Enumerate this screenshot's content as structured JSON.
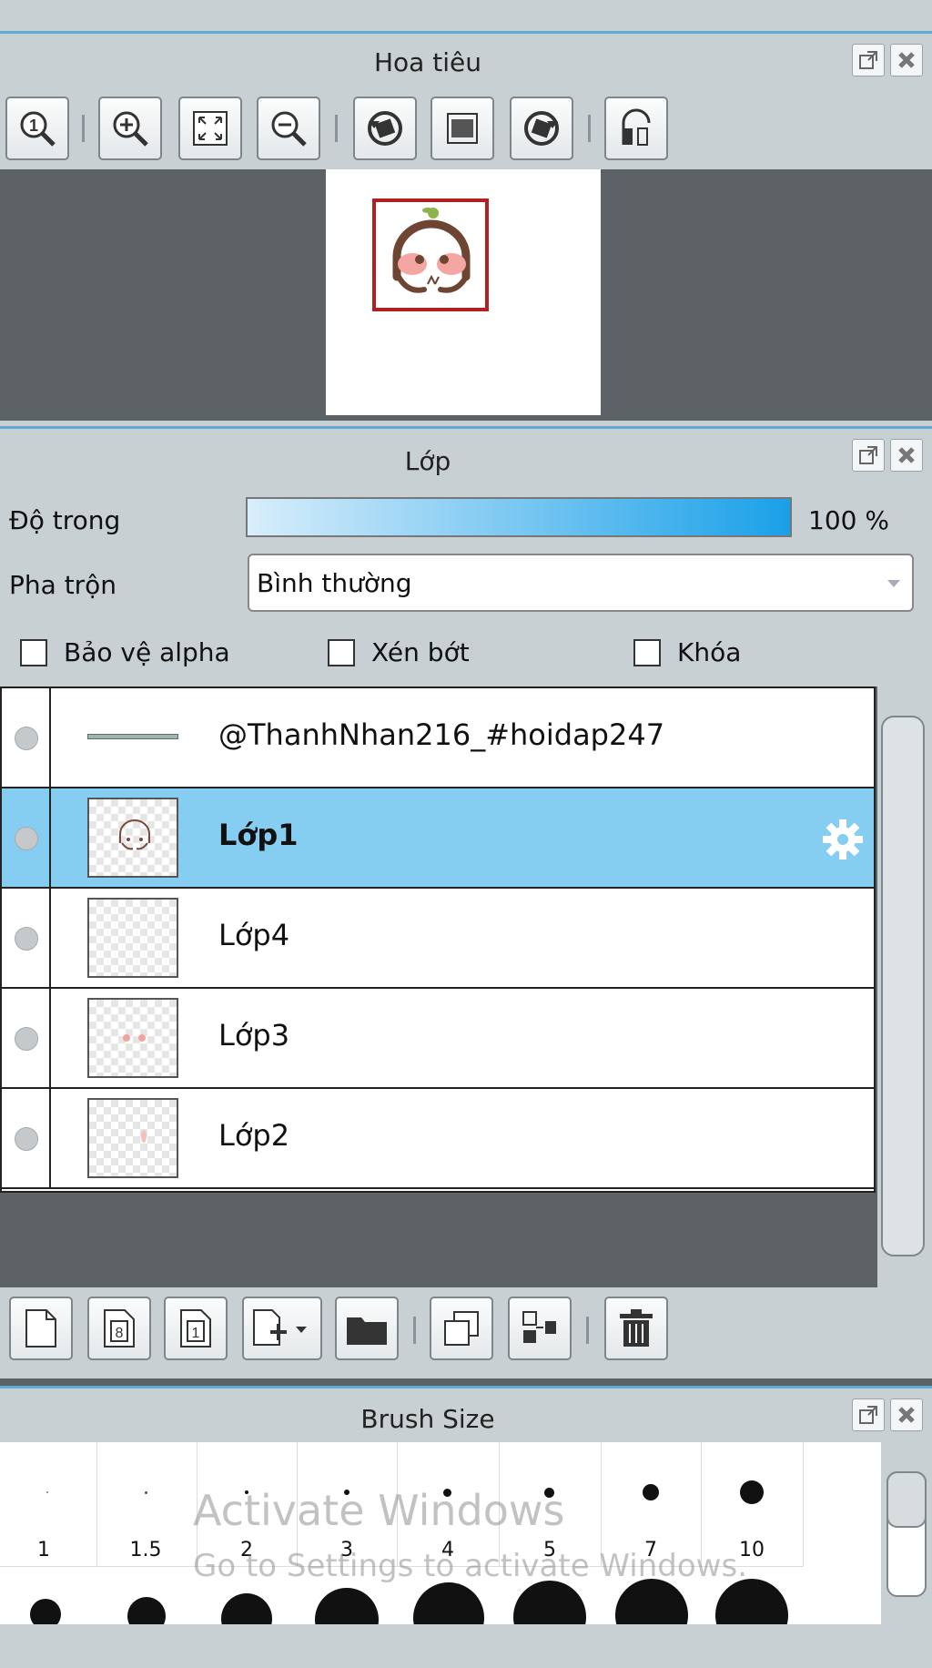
{
  "navigator": {
    "title": "Hoa tiêu",
    "toolbar": [
      {
        "name": "zoom-actual-icon",
        "glyph": "1"
      },
      {
        "name": "zoom-in-icon",
        "glyph": "+"
      },
      {
        "name": "fit-window-icon",
        "glyph": "⤢"
      },
      {
        "name": "zoom-out-icon",
        "glyph": "−"
      },
      {
        "name": "rotate-left-icon",
        "glyph": "↺"
      },
      {
        "name": "reset-rotation-icon",
        "glyph": "▣"
      },
      {
        "name": "rotate-right-icon",
        "glyph": "↻"
      },
      {
        "name": "flip-horizontal-icon",
        "glyph": "◧"
      }
    ]
  },
  "layers": {
    "title": "Lớp",
    "opacity_label": "Độ trong",
    "opacity_value": "100 %",
    "opacity_percent": 100,
    "blend_label": "Pha trộn",
    "blend_value": "Bình thường",
    "checkboxes": {
      "alpha_protect": "Bảo vệ alpha",
      "clipping": "Xén bớt",
      "lock": "Khóa"
    },
    "items": [
      {
        "name": "@ThanhNhan216_#hoidap247",
        "selected": false,
        "kind": "line"
      },
      {
        "name": "Lớp1",
        "selected": true,
        "kind": "face"
      },
      {
        "name": "Lớp4",
        "selected": false,
        "kind": "blank"
      },
      {
        "name": "Lớp3",
        "selected": false,
        "kind": "cheeks"
      },
      {
        "name": "Lớp2",
        "selected": false,
        "kind": "mark"
      }
    ],
    "bottom_toolbar": [
      {
        "name": "new-layer-icon",
        "glyph": ""
      },
      {
        "name": "new-8bit-layer-icon",
        "glyph": "8"
      },
      {
        "name": "new-1bit-layer-icon",
        "glyph": "1"
      },
      {
        "name": "add-layer-dropdown-icon",
        "glyph": "+▾"
      },
      {
        "name": "folder-icon",
        "glyph": ""
      },
      {
        "name": "duplicate-layer-icon",
        "glyph": ""
      },
      {
        "name": "merge-down-icon",
        "glyph": ""
      },
      {
        "name": "trash-icon",
        "glyph": ""
      }
    ]
  },
  "brush_size": {
    "title": "Brush Size",
    "sizes": [
      "1",
      "1.5",
      "2",
      "3",
      "4",
      "5",
      "7",
      "10"
    ]
  },
  "watermark": {
    "line1": "Activate Windows",
    "line2": "Go to Settings to activate Windows."
  }
}
